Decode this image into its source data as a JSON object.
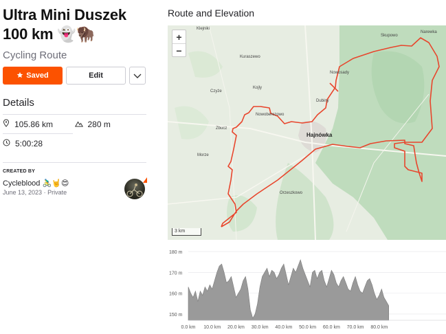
{
  "route": {
    "title_line1": "Ultra Mini Duszek",
    "title_line2": "100 km 👻🦬",
    "subtitle": "Cycling Route"
  },
  "actions": {
    "saved_label": "Saved",
    "edit_label": "Edit"
  },
  "details": {
    "heading": "Details",
    "distance": "105.86 km",
    "elevation": "280 m",
    "time": "5:00:28"
  },
  "creator": {
    "label": "CREATED BY",
    "name": "Cycleblood 🚴‍♂️🤘😍",
    "date": "June 13, 2023",
    "privacy": "Private"
  },
  "map_section": {
    "heading": "Route and Elevation",
    "zoom_in": "+",
    "zoom_out": "−",
    "scale": "3 km",
    "places": {
      "klejniki": "Klejniki",
      "kuraszewo": "Kuraszewo",
      "skupowo": "Skupowo",
      "narewka": "Narewka",
      "nowosady": "Nowosady",
      "czyze": "Czyże",
      "kojly": "Kojly",
      "dubiny": "Dubiny",
      "nowoberezowo": "Nowoberezowo",
      "zbucz": "Zbucz",
      "hajnowka": "Hajnówka",
      "morze": "Morze",
      "orzeszkowo": "Orzeszkowo"
    }
  },
  "colors": {
    "accent": "#fc5200",
    "route": "#e8452c",
    "elevation_fill": "#9a9a9a"
  },
  "chart_data": {
    "type": "area",
    "xlabel": "",
    "ylabel": "",
    "xlim": [
      0,
      108
    ],
    "ylim": [
      147,
      181
    ],
    "x_ticks": [
      "0.0 km",
      "10.0 km",
      "20.0 km",
      "30.0 km",
      "40.0 km",
      "50.0 km",
      "60.0 km",
      "70.0 km",
      "80.0 km"
    ],
    "x_tick_values": [
      0,
      10,
      20,
      30,
      40,
      50,
      60,
      70,
      80
    ],
    "y_ticks": [
      "150 m",
      "160 m",
      "170 m",
      "180 m"
    ],
    "y_tick_values": [
      150,
      160,
      170,
      180
    ],
    "x": [
      0,
      1,
      2,
      3,
      4,
      5,
      6,
      7,
      8,
      9,
      10,
      11,
      12,
      13,
      14,
      15,
      16,
      17,
      18,
      19,
      20,
      21,
      22,
      23,
      24,
      25,
      26,
      27,
      28,
      29,
      30,
      31,
      32,
      33,
      34,
      35,
      36,
      37,
      38,
      39,
      40,
      41,
      42,
      43,
      44,
      45,
      46,
      47,
      48,
      49,
      50,
      51,
      52,
      53,
      54,
      55,
      56,
      57,
      58,
      59,
      60,
      61,
      62,
      63,
      64,
      65,
      66,
      67,
      68,
      69,
      70,
      71,
      72,
      73,
      74,
      75,
      76,
      77,
      78,
      79,
      80,
      81,
      82,
      83,
      84
    ],
    "series": [
      {
        "values": [
          163,
          160,
          158,
          161,
          156,
          161,
          159,
          163,
          161,
          164,
          162,
          166,
          170,
          173,
          174,
          170,
          165,
          166,
          168,
          163,
          158,
          160,
          162,
          166,
          168,
          162,
          152,
          148,
          150,
          155,
          163,
          168,
          170,
          172,
          168,
          171,
          170,
          167,
          169,
          172,
          174,
          169,
          164,
          168,
          172,
          170,
          173,
          176,
          172,
          169,
          166,
          163,
          170,
          171,
          167,
          170,
          171,
          166,
          163,
          167,
          171,
          169,
          165,
          163,
          166,
          168,
          165,
          162,
          161,
          165,
          168,
          164,
          161,
          160,
          163,
          166,
          167,
          164,
          160,
          157,
          159,
          162,
          158,
          156,
          154
        ]
      }
    ]
  }
}
